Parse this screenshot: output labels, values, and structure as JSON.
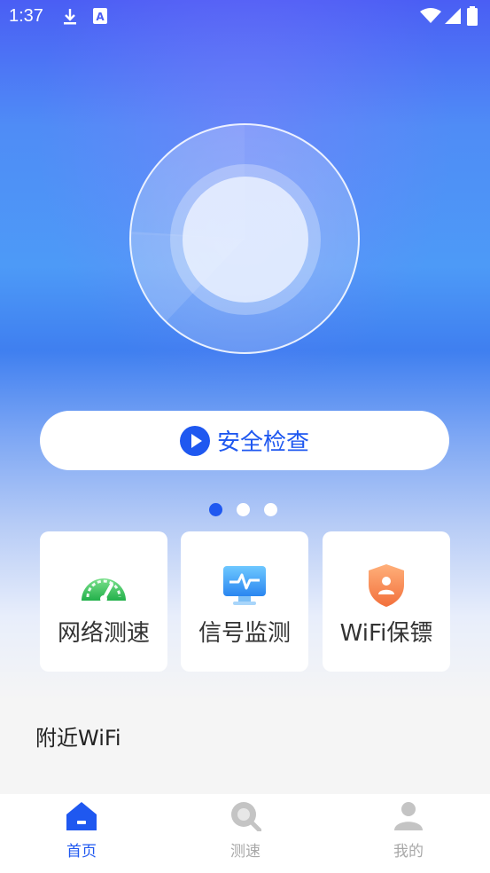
{
  "status_bar": {
    "time": "1:37",
    "left_icons": [
      "download-icon",
      "text-a-icon"
    ],
    "right_icons": [
      "wifi-icon",
      "signal-icon",
      "battery-icon"
    ]
  },
  "main": {
    "check_button_label": "安全检查",
    "pager": {
      "count": 3,
      "active_index": 0
    }
  },
  "features": [
    {
      "label": "网络测速",
      "icon": "speedometer-icon"
    },
    {
      "label": "信号监测",
      "icon": "monitor-pulse-icon"
    },
    {
      "label": "WiFi保镖",
      "icon": "shield-user-icon"
    }
  ],
  "nearby_title": "附近WiFi",
  "bottom_nav": [
    {
      "label": "首页",
      "icon": "home-icon",
      "active": true
    },
    {
      "label": "测速",
      "icon": "search-icon",
      "active": false
    },
    {
      "label": "我的",
      "icon": "user-icon",
      "active": false
    }
  ],
  "colors": {
    "accent": "#1f58f0",
    "inactive": "#a8a8a8"
  }
}
